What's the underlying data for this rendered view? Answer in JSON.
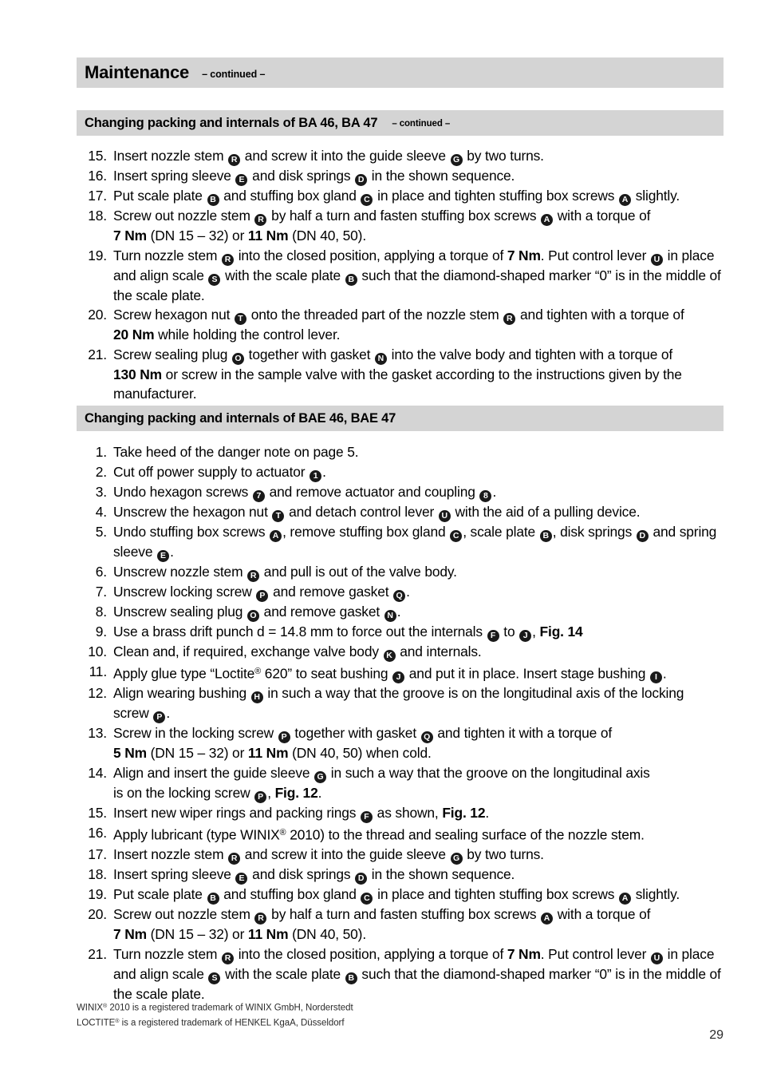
{
  "header": {
    "title": "Maintenance",
    "continued": "– continued –"
  },
  "sections": [
    {
      "title": "Changing packing and internals of BA 46, BA 47",
      "continued": "– continued –",
      "items": [
        {
          "num": "15.",
          "html": "Insert nozzle stem <span class=\"mk\" data-name=\"marker-R\" data-interactable=\"false\">R</span> and screw it into the guide sleeve <span class=\"mk\" data-name=\"marker-G\" data-interactable=\"false\">G</span> by two turns."
        },
        {
          "num": "16.",
          "html": "Insert spring sleeve <span class=\"mk\" data-name=\"marker-E\" data-interactable=\"false\">E</span> and disk springs <span class=\"mk\" data-name=\"marker-D\" data-interactable=\"false\">D</span> in the shown sequence."
        },
        {
          "num": "17.",
          "html": "Put scale plate <span class=\"mk\" data-name=\"marker-B\" data-interactable=\"false\">B</span> and stuffing box gland <span class=\"mk\" data-name=\"marker-C\" data-interactable=\"false\">C</span> in place and tighten stuffing box screws <span class=\"mk\" data-name=\"marker-A\" data-interactable=\"false\">A</span> slightly."
        },
        {
          "num": "18.",
          "html": "Screw out nozzle stem <span class=\"mk\" data-name=\"marker-R\" data-interactable=\"false\">R</span> by half a turn and fasten stuffing box screws <span class=\"mk\" data-name=\"marker-A\" data-interactable=\"false\">A</span> with a torque of<br><b>7 Nm</b> (DN 15 – 32) or <b>11 Nm</b> (DN 40, 50)."
        },
        {
          "num": "19.",
          "html": "Turn nozzle stem <span class=\"mk\" data-name=\"marker-R\" data-interactable=\"false\">R</span> into the closed position, applying a torque of <b>7 Nm</b>. Put control lever <span class=\"mk\" data-name=\"marker-U\" data-interactable=\"false\">U</span> in place and align scale <span class=\"mk\" data-name=\"marker-S\" data-interactable=\"false\">S</span> with the scale plate <span class=\"mk\" data-name=\"marker-B\" data-interactable=\"false\">B</span> such that the diamond-shaped marker “0” is in the middle of the scale plate."
        },
        {
          "num": "20.",
          "html": "Screw hexagon nut <span class=\"mk\" data-name=\"marker-T\" data-interactable=\"false\">T</span> onto the threaded part of the nozzle stem <span class=\"mk\" data-name=\"marker-R\" data-interactable=\"false\">R</span> and tighten with a torque of<br><b>20 Nm</b> while holding the control lever."
        },
        {
          "num": "21.",
          "html": "Screw sealing plug <span class=\"mk\" data-name=\"marker-O\" data-interactable=\"false\">O</span> together with gasket <span class=\"mk\" data-name=\"marker-N\" data-interactable=\"false\">N</span> into the valve body and tighten with a torque of<br><b>130 Nm</b> or screw in the sample valve with the gasket according to the instructions given by the manufacturer."
        }
      ]
    },
    {
      "title": "Changing packing and internals of BAE 46, BAE 47",
      "continued": "",
      "items": [
        {
          "num": "1.",
          "html": "Take heed of the danger note on page 5."
        },
        {
          "num": "2.",
          "html": "Cut off power supply to actuator <span class=\"mk\" data-name=\"marker-1\" data-interactable=\"false\">1</span>."
        },
        {
          "num": "3.",
          "html": "Undo hexagon screws <span class=\"mk\" data-name=\"marker-7\" data-interactable=\"false\">7</span> and remove actuator and coupling <span class=\"mk\" data-name=\"marker-8\" data-interactable=\"false\">8</span>."
        },
        {
          "num": "4.",
          "html": "Unscrew the hexagon nut <span class=\"mk\" data-name=\"marker-T\" data-interactable=\"false\">T</span> and detach control lever <span class=\"mk\" data-name=\"marker-U\" data-interactable=\"false\">U</span> with the aid of a pulling device."
        },
        {
          "num": "5.",
          "html": "Undo stuffing box screws <span class=\"mk\" data-name=\"marker-A\" data-interactable=\"false\">A</span>, remove stuffing box gland <span class=\"mk\" data-name=\"marker-C\" data-interactable=\"false\">C</span>, scale plate <span class=\"mk\" data-name=\"marker-B\" data-interactable=\"false\">B</span>, disk springs <span class=\"mk\" data-name=\"marker-D\" data-interactable=\"false\">D</span> and spring sleeve <span class=\"mk\" data-name=\"marker-E\" data-interactable=\"false\">E</span>."
        },
        {
          "num": "6.",
          "html": "Unscrew nozzle stem <span class=\"mk\" data-name=\"marker-R\" data-interactable=\"false\">R</span> and pull is out of the valve body."
        },
        {
          "num": "7.",
          "html": "Unscrew locking screw <span class=\"mk\" data-name=\"marker-P\" data-interactable=\"false\">P</span> and remove gasket <span class=\"mk\" data-name=\"marker-Q\" data-interactable=\"false\">Q</span>."
        },
        {
          "num": "8.",
          "html": "Unscrew sealing plug <span class=\"mk\" data-name=\"marker-O\" data-interactable=\"false\">O</span> and remove gasket <span class=\"mk\" data-name=\"marker-N\" data-interactable=\"false\">N</span>."
        },
        {
          "num": "9.",
          "html": "Use a brass drift punch d = 14.8 mm to force out the internals <span class=\"mk\" data-name=\"marker-F\" data-interactable=\"false\">F</span> to <span class=\"mk\" data-name=\"marker-J\" data-interactable=\"false\">J</span>, <b>Fig. 14</b>"
        },
        {
          "num": "10.",
          "html": "Clean and, if required, exchange valve body <span class=\"mk\" data-name=\"marker-K\" data-interactable=\"false\">K</span> and internals."
        },
        {
          "num": "11.",
          "html": "Apply glue type “Loctite<span class=\"sup\">®</span> 620” to seat bushing <span class=\"mk\" data-name=\"marker-J\" data-interactable=\"false\">J</span> and put it in place. Insert stage bushing <span class=\"mk\" data-name=\"marker-I\" data-interactable=\"false\">I</span>."
        },
        {
          "num": "12.",
          "html": "Align wearing bushing <span class=\"mk\" data-name=\"marker-H\" data-interactable=\"false\">H</span> in such a way that the groove is on the longitudinal axis of the locking screw <span class=\"mk\" data-name=\"marker-P\" data-interactable=\"false\">P</span>."
        },
        {
          "num": "13.",
          "html": "Screw in the locking screw <span class=\"mk\" data-name=\"marker-P\" data-interactable=\"false\">P</span> together with gasket <span class=\"mk\" data-name=\"marker-Q\" data-interactable=\"false\">Q</span> and tighten it with a torque of<br><b>5 Nm</b> (DN 15 – 32) or <b>11 Nm</b> (DN 40, 50) when cold."
        },
        {
          "num": "14.",
          "html": "Align and insert the guide sleeve <span class=\"mk\" data-name=\"marker-G\" data-interactable=\"false\">G</span> in such a way that the groove on the longitudinal axis<br>is on the locking screw <span class=\"mk\" data-name=\"marker-P\" data-interactable=\"false\">P</span>, <b>Fig. 12</b>."
        },
        {
          "num": "15.",
          "html": "Insert new wiper rings and packing rings <span class=\"mk\" data-name=\"marker-F\" data-interactable=\"false\">F</span> as shown, <b>Fig. 12</b>."
        },
        {
          "num": "16.",
          "html": "Apply lubricant (type WINIX<span class=\"sup\">®</span> 2010) to the thread and sealing surface of the nozzle stem."
        },
        {
          "num": "17.",
          "html": "Insert nozzle stem <span class=\"mk\" data-name=\"marker-R\" data-interactable=\"false\">R</span> and screw it into the guide sleeve <span class=\"mk\" data-name=\"marker-G\" data-interactable=\"false\">G</span> by two turns."
        },
        {
          "num": "18.",
          "html": "Insert spring sleeve <span class=\"mk\" data-name=\"marker-E\" data-interactable=\"false\">E</span> and disk springs <span class=\"mk\" data-name=\"marker-D\" data-interactable=\"false\">D</span> in the shown sequence."
        },
        {
          "num": "19.",
          "html": "Put scale plate <span class=\"mk\" data-name=\"marker-B\" data-interactable=\"false\">B</span> and stuffing box gland <span class=\"mk\" data-name=\"marker-C\" data-interactable=\"false\">C</span> in place and tighten stuffing box screws <span class=\"mk\" data-name=\"marker-A\" data-interactable=\"false\">A</span> slightly."
        },
        {
          "num": "20.",
          "html": "Screw out nozzle stem <span class=\"mk\" data-name=\"marker-R\" data-interactable=\"false\">R</span> by half a turn and fasten stuffing box screws <span class=\"mk\" data-name=\"marker-A\" data-interactable=\"false\">A</span> with a torque of<br><b>7 Nm</b> (DN 15 – 32) or <b>11 Nm</b> (DN 40, 50)."
        },
        {
          "num": "21.",
          "html": "Turn nozzle stem <span class=\"mk\" data-name=\"marker-R\" data-interactable=\"false\">R</span> into the closed position, applying a torque of <b>7 Nm</b>. Put control lever <span class=\"mk\" data-name=\"marker-U\" data-interactable=\"false\">U</span> in place and align scale <span class=\"mk\" data-name=\"marker-S\" data-interactable=\"false\">S</span> with the scale plate <span class=\"mk\" data-name=\"marker-B\" data-interactable=\"false\">B</span> such that the diamond-shaped marker “0” is in the middle of the scale plate."
        }
      ]
    }
  ],
  "footnotes": [
    "WINIX<span class=\"sup\">®</span> 2010 is a registered trademark of WINIX GmbH, Norderstedt",
    "LOCTITE<span class=\"sup\">®</span> is a registered trademark of HENKEL KgaA, Düsseldorf"
  ],
  "page_number": "29",
  "colors": {
    "band": "#d4d4d4",
    "text": "#000000",
    "marker_fill": "#1a1a1a",
    "marker_text": "#ffffff"
  }
}
